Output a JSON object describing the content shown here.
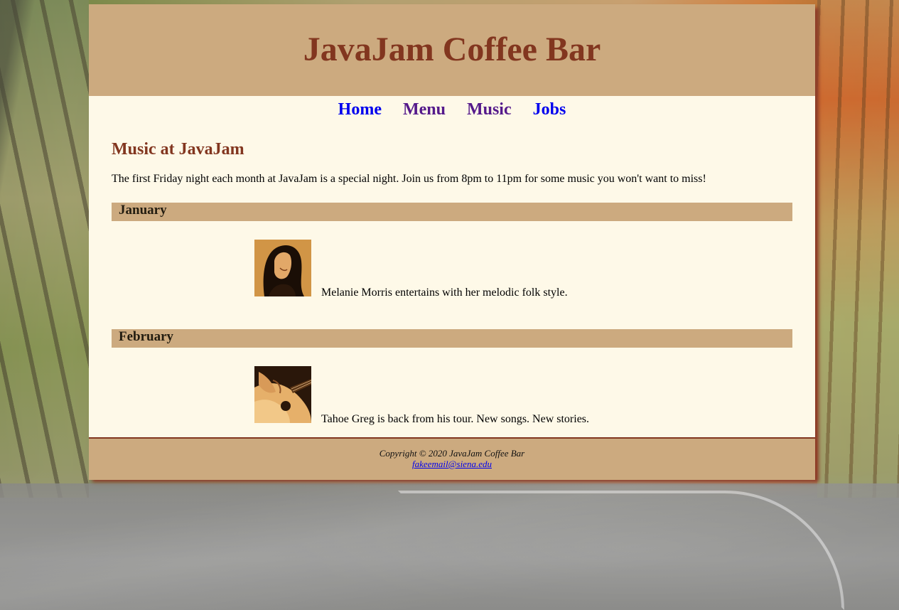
{
  "header": {
    "title": "JavaJam Coffee Bar"
  },
  "nav": {
    "items": [
      "Home",
      "Menu",
      "Music",
      "Jobs"
    ]
  },
  "main": {
    "heading": "Music at JavaJam",
    "intro": "The first Friday night each month at JavaJam is a special night. Join us from 8pm to 11pm for some music you won't want to miss!",
    "months": [
      {
        "name": "January",
        "performer_caption": "Melanie Morris entertains with her melodic folk style."
      },
      {
        "name": "February",
        "performer_caption": "Tahoe Greg is back from his tour. New songs. New stories."
      }
    ]
  },
  "footer": {
    "copyright": "Copyright © 2020 JavaJam Coffee Bar",
    "email": "fakeemail@siena.edu"
  },
  "colors": {
    "brand_brown": "#82361f",
    "tan": "#ccaa7f",
    "cream": "#fef9e8"
  }
}
